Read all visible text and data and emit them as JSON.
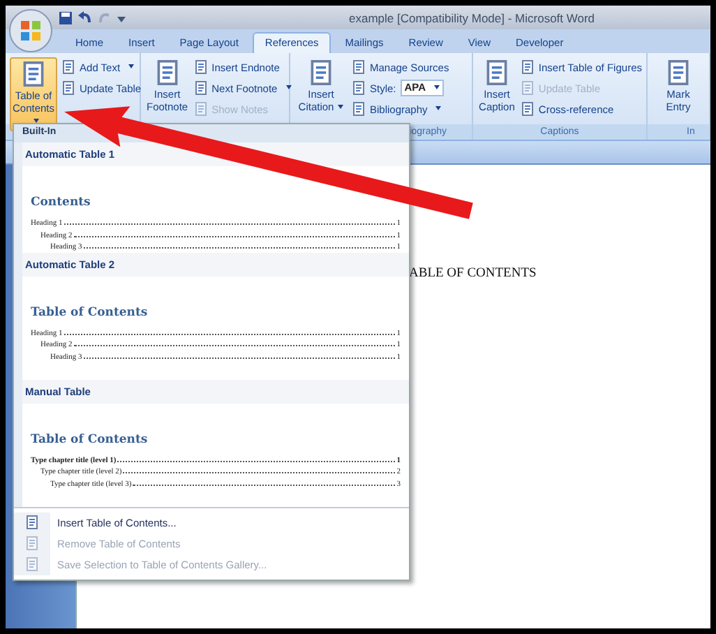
{
  "window": {
    "title": "example [Compatibility Mode] - Microsoft Word"
  },
  "tabs": [
    {
      "label": "Home",
      "selected": false
    },
    {
      "label": "Insert",
      "selected": false
    },
    {
      "label": "Page Layout",
      "selected": false
    },
    {
      "label": "References",
      "selected": true
    },
    {
      "label": "Mailings",
      "selected": false
    },
    {
      "label": "Review",
      "selected": false
    },
    {
      "label": "View",
      "selected": false
    },
    {
      "label": "Developer",
      "selected": false
    }
  ],
  "ribbon": {
    "groups": [
      {
        "buttons": [
          {
            "kind": "large",
            "label": "Table of Contents",
            "dropdown": true,
            "highlighted": true
          },
          {
            "kind": "small",
            "label": "Add Text",
            "dropdown": true
          },
          {
            "kind": "small",
            "label": "Update Table"
          }
        ]
      },
      {
        "buttons": [
          {
            "kind": "large",
            "label": "Insert Footnote"
          },
          {
            "kind": "small",
            "label": "Insert Endnote"
          },
          {
            "kind": "small",
            "label": "Next Footnote",
            "dropdown": true
          },
          {
            "kind": "small",
            "label": "Show Notes",
            "disabled": true
          }
        ]
      },
      {
        "label": "iography",
        "buttons": [
          {
            "kind": "large",
            "label": "Insert Citation",
            "dropdown": true
          },
          {
            "kind": "small",
            "label": "Manage Sources"
          },
          {
            "kind": "field",
            "label": "Style:",
            "value": "APA"
          },
          {
            "kind": "small",
            "label": "Bibliography",
            "dropdown": true
          }
        ]
      },
      {
        "label": "Captions",
        "buttons": [
          {
            "kind": "large",
            "label": "Insert Caption"
          },
          {
            "kind": "small",
            "label": "Insert Table of Figures"
          },
          {
            "kind": "small",
            "label": "Update Table",
            "disabled": true
          },
          {
            "kind": "small",
            "label": "Cross-reference"
          }
        ]
      },
      {
        "label": "In",
        "buttons": [
          {
            "kind": "large",
            "label": "Mark Entry"
          }
        ]
      }
    ]
  },
  "document": {
    "text": "ABLE OF CONTENTS"
  },
  "toc_menu": {
    "section": "Built-In",
    "gallery": [
      {
        "title": "Automatic Table 1",
        "kind": "automatic",
        "heading": "Contents",
        "entries": [
          {
            "text": "Heading 1",
            "page": "1",
            "children": [
              {
                "text": "Heading 2",
                "page": "1",
                "children": [
                  {
                    "text": "Heading 3",
                    "page": "1"
                  }
                ]
              }
            ]
          }
        ]
      },
      {
        "title": "Automatic Table 2",
        "kind": "automatic",
        "heading": "Table of Contents",
        "entries": [
          {
            "text": "Heading 1",
            "page": "1",
            "children": [
              {
                "text": "Heading 2",
                "page": "1",
                "children": [
                  {
                    "text": "Heading 3",
                    "page": "1"
                  }
                ]
              }
            ]
          }
        ]
      },
      {
        "title": "Manual Table",
        "kind": "manual",
        "heading": "Table of Contents",
        "entries": [
          {
            "text": "Type chapter title (level 1)",
            "page": "1",
            "children": [
              {
                "text": "Type chapter title (level 2)",
                "page": "2",
                "children": [
                  {
                    "text": "Type chapter title (level 3)",
                    "page": "3"
                  }
                ]
              }
            ]
          }
        ]
      }
    ],
    "commands": [
      {
        "label": "Insert Table of Contents...",
        "disabled": false
      },
      {
        "label": "Remove Table of Contents",
        "disabled": true
      },
      {
        "label": "Save Selection to Table of Contents Gallery...",
        "disabled": true
      }
    ]
  }
}
